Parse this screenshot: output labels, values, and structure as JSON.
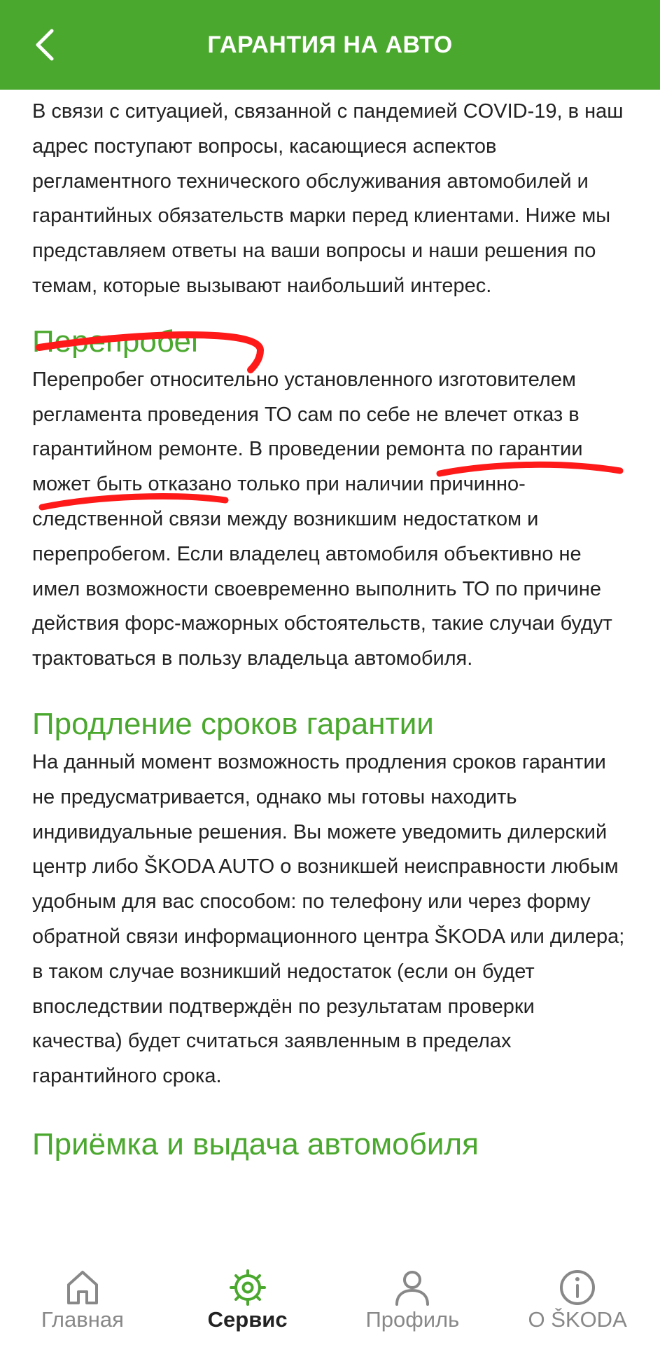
{
  "header": {
    "title": "ГАРАНТИЯ НА АВТО",
    "back_icon": "chevron-left-icon"
  },
  "intro": "В связи с ситуацией, связанной с пандемией COVID-19, в наш адрес поступают вопросы, касающиеся аспектов регламентного технического обслуживания автомобилей и гарантийных обязательств марки перед клиентами. Ниже мы представляем ответы на ваши вопросы и наши решения по темам, которые вызывают  наибольший интерес.",
  "sections": [
    {
      "title": "Перепробег",
      "text": "Перепробег относительно установленного изготовителем регламента проведения ТО сам по себе не влечет отказ в гарантийном ремонте. В проведении ремонта по гарантии может быть отказано только при наличии причинно-следственной связи между возникшим недостатком и перепробегом. Если владелец автомобиля объективно не имел возможности своевременно выполнить ТО по причине действия форс-мажорных обстоятельств, такие случаи будут трактоваться в пользу владельца автомобиля."
    },
    {
      "title": "Продление сроков гарантии",
      "text": "На данный момент возможность продления сроков гарантии не предусматривается, однако мы готовы находить индивидуальные решения. Вы можете уведомить дилерский центр либо ŠKODA AUTO о возникшей неисправности любым удобным для вас способом: по телефону или через форму обратной связи информационного центра ŠKODA или дилера; в таком случае возникший недостаток (если он будет впоследствии подтверждён по результатам проверки качества) будет считаться заявленным в пределах гарантийного срока."
    },
    {
      "title": "Приёмка и выдача автомобиля"
    }
  ],
  "colors": {
    "brand_green": "#4ba82e",
    "annotation_red": "#ff1a1a",
    "text": "#222222",
    "inactive_nav": "#888888"
  },
  "nav": {
    "items": [
      {
        "label": "Главная",
        "icon": "home-icon",
        "active": false
      },
      {
        "label": "Сервис",
        "icon": "gear-icon",
        "active": true
      },
      {
        "label": "Профиль",
        "icon": "user-icon",
        "active": false
      },
      {
        "label": "О ŠKODA",
        "icon": "info-icon",
        "active": false
      }
    ]
  }
}
